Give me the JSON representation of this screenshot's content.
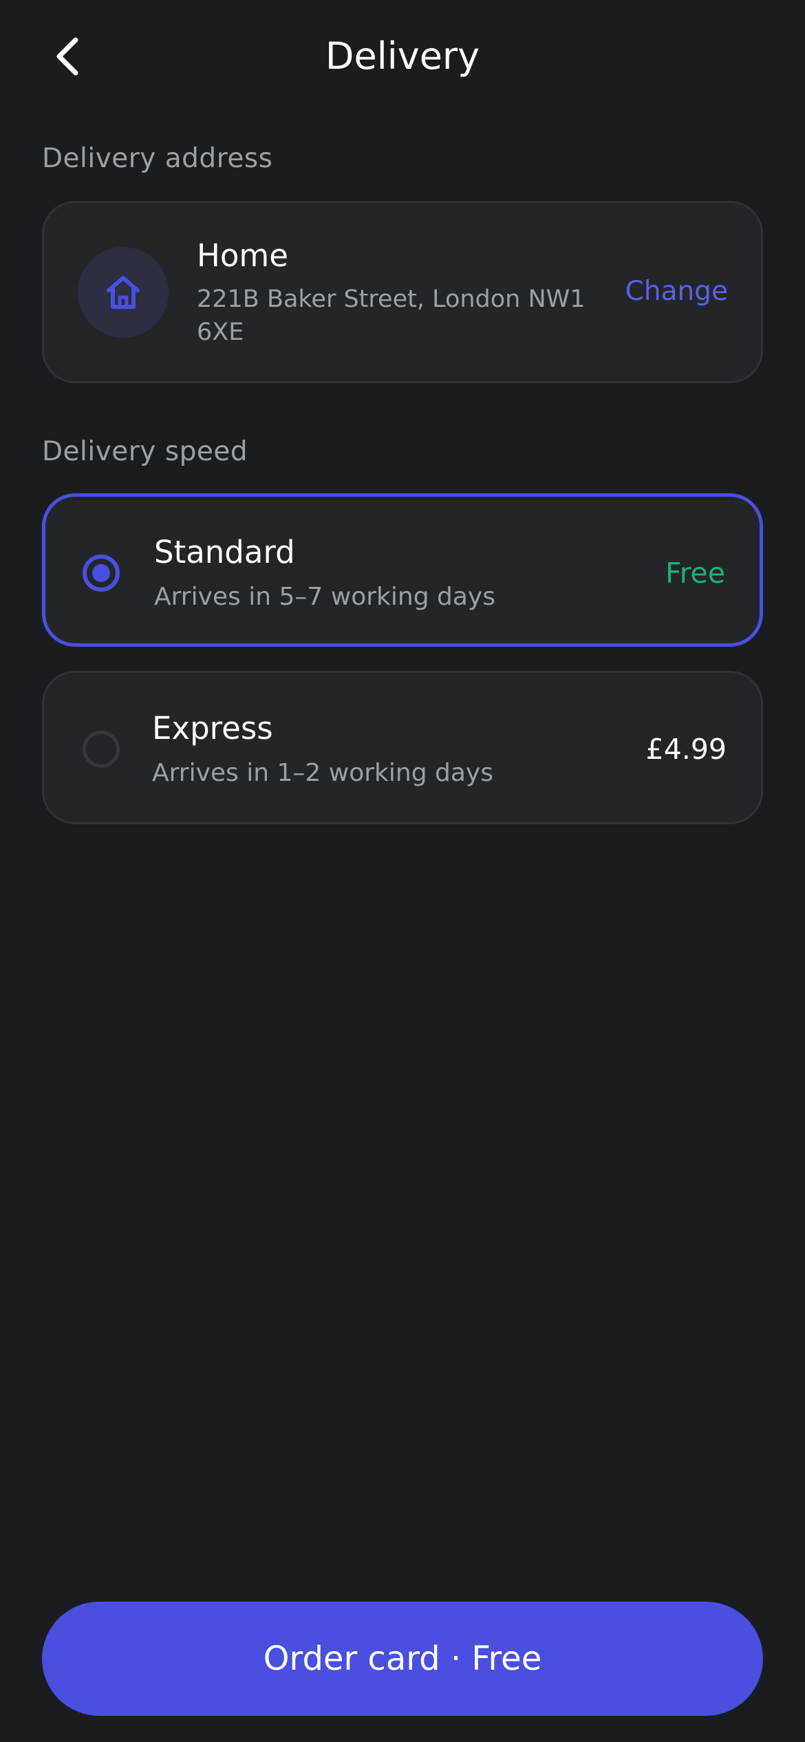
{
  "header": {
    "title": "Delivery",
    "back_icon": "chevron-left-icon"
  },
  "address": {
    "section_label": "Delivery address",
    "name": "Home",
    "line": "221B Baker Street, London NW1 6XE",
    "icon": "home-icon",
    "change_label": "Change"
  },
  "speed": {
    "section_label": "Delivery speed",
    "options": [
      {
        "title": "Standard",
        "subtitle": "Arrives in 5–7 working days",
        "price": "Free",
        "selected": true
      },
      {
        "title": "Express",
        "subtitle": "Arrives in 1–2 working days",
        "price": "£4.99",
        "selected": false
      }
    ]
  },
  "cta": {
    "label": "Order card · Free"
  },
  "colors": {
    "background": "#1a1d20",
    "card": "#232629",
    "accent": "#4a4fe0",
    "free": "#1fae7a",
    "muted_text": "#9aa0a7"
  }
}
